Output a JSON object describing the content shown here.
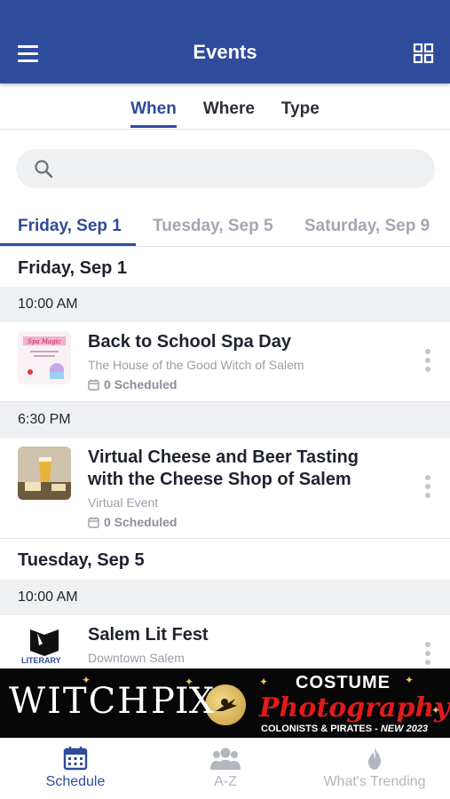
{
  "app_bar": {
    "title": "Events",
    "menu_icon": "hamburger-menu-icon",
    "grid_icon": "grid-view-icon"
  },
  "filter_tabs": {
    "items": [
      "When",
      "Where",
      "Type"
    ],
    "active": "When"
  },
  "search": {
    "placeholder": ""
  },
  "date_tabs": {
    "items": [
      "Friday, Sep 1",
      "Tuesday, Sep 5",
      "Saturday, Sep 9"
    ],
    "active": "Friday, Sep 1"
  },
  "sections": [
    {
      "day": "Friday, Sep 1",
      "times": [
        {
          "time": "10:00 AM",
          "events": [
            {
              "title": "Back to School Spa Day",
              "venue": "The House of the Good Witch of Salem",
              "scheduled": "0 Scheduled"
            }
          ]
        },
        {
          "time": "6:30 PM",
          "events": [
            {
              "title": "Virtual Cheese and Beer Tasting with the Cheese Shop of Salem",
              "venue": "Virtual Event",
              "scheduled": "0 Scheduled"
            }
          ]
        }
      ]
    },
    {
      "day": "Tuesday, Sep 5",
      "times": [
        {
          "time": "10:00 AM",
          "events": [
            {
              "title": "Salem Lit Fest",
              "venue": "Downtown Salem",
              "scheduled": ""
            }
          ]
        }
      ]
    }
  ],
  "ad_banner": {
    "left_text": "WITCH",
    "right_text": "PIX",
    "headline": "COSTUME",
    "script_text": "Photography",
    "subline": "COLONISTS & PIRATES - ",
    "subline_new": "NEW 2023"
  },
  "bottom_nav": {
    "items": [
      {
        "label": "Schedule",
        "icon": "calendar-icon",
        "active": true
      },
      {
        "label": "A-Z",
        "icon": "people-icon",
        "active": false
      },
      {
        "label": "What's Trending",
        "icon": "flame-icon",
        "active": false
      }
    ]
  },
  "colors": {
    "primary": "#2f4b9b",
    "muted_text": "#9a9ea8",
    "section_bg": "#eff0f2",
    "ad_red": "#e01a1a"
  }
}
